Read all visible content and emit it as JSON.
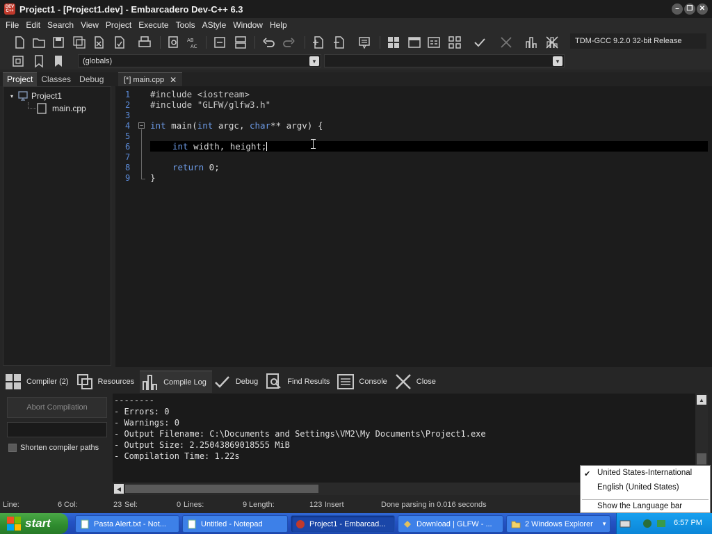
{
  "window": {
    "title": "Project1 - [Project1.dev] - Embarcadero Dev-C++ 6.3",
    "icon_text": "DEV C++"
  },
  "menu": [
    "File",
    "Edit",
    "Search",
    "View",
    "Project",
    "Execute",
    "Tools",
    "AStyle",
    "Window",
    "Help"
  ],
  "toolbar": {
    "compiler_select": "TDM-GCC 9.2.0 32-bit Release",
    "scope_select": "(globals)",
    "member_select": ""
  },
  "left_panel": {
    "tabs": [
      "Project",
      "Classes",
      "Debug"
    ],
    "active_tab": "Project",
    "tree": {
      "project": "Project1",
      "file": "main.cpp"
    }
  },
  "editor": {
    "tab_label": "[*] main.cpp",
    "lines": [
      {
        "n": "1"
      },
      {
        "n": "2"
      },
      {
        "n": "3"
      },
      {
        "n": "4"
      },
      {
        "n": "5"
      },
      {
        "n": "6"
      },
      {
        "n": "7"
      },
      {
        "n": "8"
      },
      {
        "n": "9"
      }
    ],
    "code": {
      "l1": "#include <iostream>",
      "l2": "#include \"GLFW/glfw3.h\"",
      "l4_kw1": "int",
      "l4_rest1": " main(",
      "l4_kw2": "int",
      "l4_rest2": " argc, ",
      "l4_kw3": "char",
      "l4_rest3": "** argv) {",
      "l6_kw": "int",
      "l6_rest": " width, height;",
      "l8_kw": "return",
      "l8_rest": " 0;",
      "l9": "}"
    }
  },
  "bottom_tabs": [
    "Compiler (2)",
    "Resources",
    "Compile Log",
    "Debug",
    "Find Results",
    "Console",
    "Close"
  ],
  "active_bottom_tab": "Compile Log",
  "compile_panel": {
    "abort_label": "Abort Compilation",
    "shorten_paths_label": "Shorten compiler paths",
    "shorten_paths_checked": false
  },
  "compile_log": [
    "--------",
    "- Errors: 0",
    "- Warnings: 0",
    "- Output Filename: C:\\Documents and Settings\\VM2\\My Documents\\Project1.exe",
    "- Output Size: 2.25043869018555 MiB",
    "- Compilation Time: 1.22s"
  ],
  "statusbar": {
    "line_label": "Line:",
    "line_value": "6",
    "col_label": "Col:",
    "col_value": "23",
    "sel_label": "Sel:",
    "sel_value": "0",
    "lines_label": "Lines:",
    "lines_value": "9",
    "length_label": "Length:",
    "length_value": "123",
    "mode": "Insert",
    "message": "Done parsing in 0.016 seconds"
  },
  "language_menu": {
    "items": [
      "United States-International",
      "English (United States)"
    ],
    "checked_index": 0,
    "show_bar": "Show the Language bar"
  },
  "taskbar": {
    "start_label": "start",
    "tasks": [
      {
        "label": "Pasta Alert.txt - Not...",
        "active": false
      },
      {
        "label": "Untitled - Notepad",
        "active": false
      },
      {
        "label": "Project1 - Embarcad...",
        "active": true
      },
      {
        "label": "Download | GLFW - ...",
        "active": false
      },
      {
        "label": "2 Windows Explorer",
        "active": false
      }
    ],
    "clock": "6:57 PM"
  },
  "colors": {
    "accent": "#6d9be6",
    "line_number": "#5b8ad8",
    "editor_bg": "#1c1c1c",
    "taskbar": "#2453c4",
    "start": "#2e8b2e"
  }
}
